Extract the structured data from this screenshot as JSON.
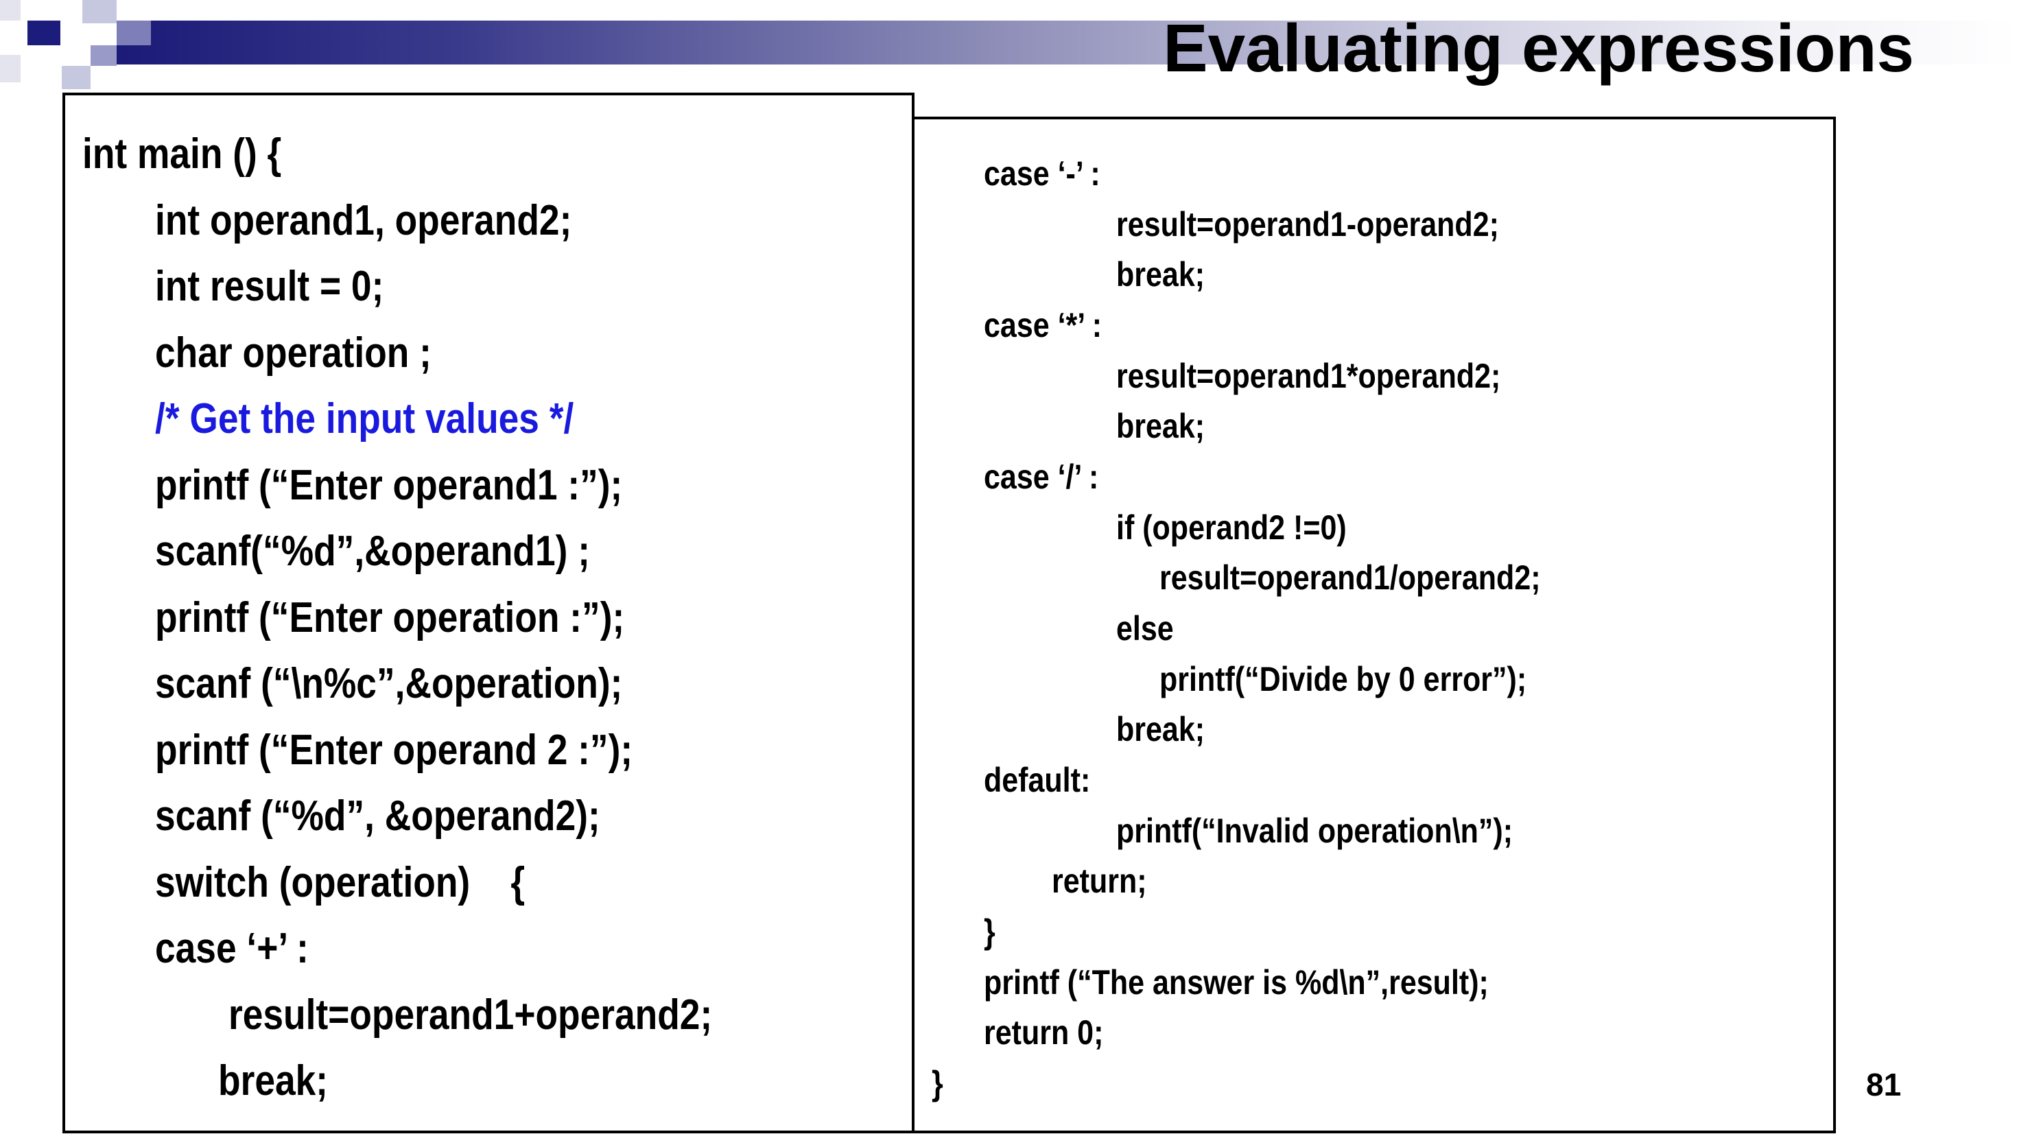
{
  "title": "Evaluating expressions",
  "page_number": "81",
  "colors": {
    "title_bar_dark": "#1b1b78",
    "comment": "#1a1adf",
    "text": "#000000"
  },
  "left_code": [
    "int main () {",
    "int operand1, operand2;",
    "int result = 0;",
    "char operation ;",
    "/* Get the input values */",
    "printf (“Enter operand1 :”);",
    "scanf(“%d”,&operand1) ;",
    "printf (“Enter operation :”);",
    "scanf (“\\n%c”,&operation);",
    "printf (“Enter operand 2 :”);",
    "scanf (“%d”, &operand2);",
    "switch (operation)    {",
    "case ‘+’ :",
    "result=operand1+operand2;",
    "break;"
  ],
  "right_code": [
    "case ‘-’ :",
    "result=operand1-operand2;",
    "break;",
    "case ‘*’ :",
    "result=operand1*operand2;",
    "break;",
    "case ‘/’ :",
    "if (operand2 !=0)",
    "result=operand1/operand2;",
    "else",
    "printf(“Divide by 0 error”);",
    "break;",
    "default:",
    "printf(“Invalid operation\\n”);",
    "return;",
    "}",
    "printf (“The answer is %d\\n”,result);",
    "return 0;",
    "}"
  ]
}
